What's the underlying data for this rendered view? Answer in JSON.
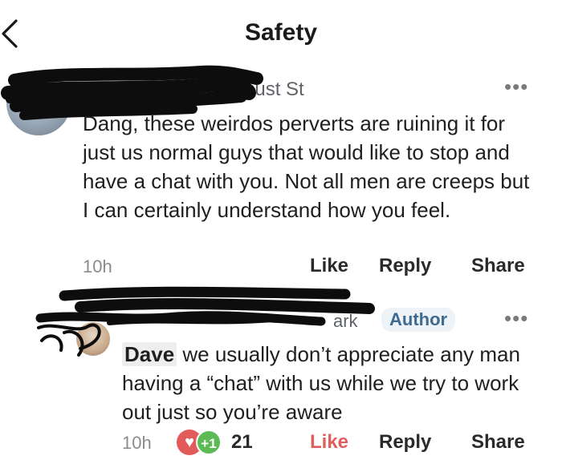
{
  "header": {
    "title": "Safety",
    "back_icon": "chevron-left-icon"
  },
  "comment1": {
    "author_visible": "ocust St",
    "text": "Dang, these weirdos perverts are ruining it for just us normal guys that would like to stop and have a chat with you. Not all men are creeps but I can certainly understand how you feel.",
    "time": "10h",
    "like": "Like",
    "reply": "Reply",
    "share": "Share"
  },
  "comment2": {
    "author_visible": "ark",
    "badge": "Author",
    "mention": "Dave",
    "text": " we usually don’t appreciate any man having a “chat” with us while we try to work out just so you’re aware",
    "time": "10h",
    "reactions": {
      "heart": "♥",
      "plus": "+1",
      "count": "21"
    },
    "like": "Like",
    "reply": "Reply",
    "share": "Share"
  },
  "more_icon": "•••",
  "colors": {
    "like_active": "#e15d5d",
    "author_badge_bg": "#eef3f8",
    "author_badge_text": "#3f6a8f"
  }
}
